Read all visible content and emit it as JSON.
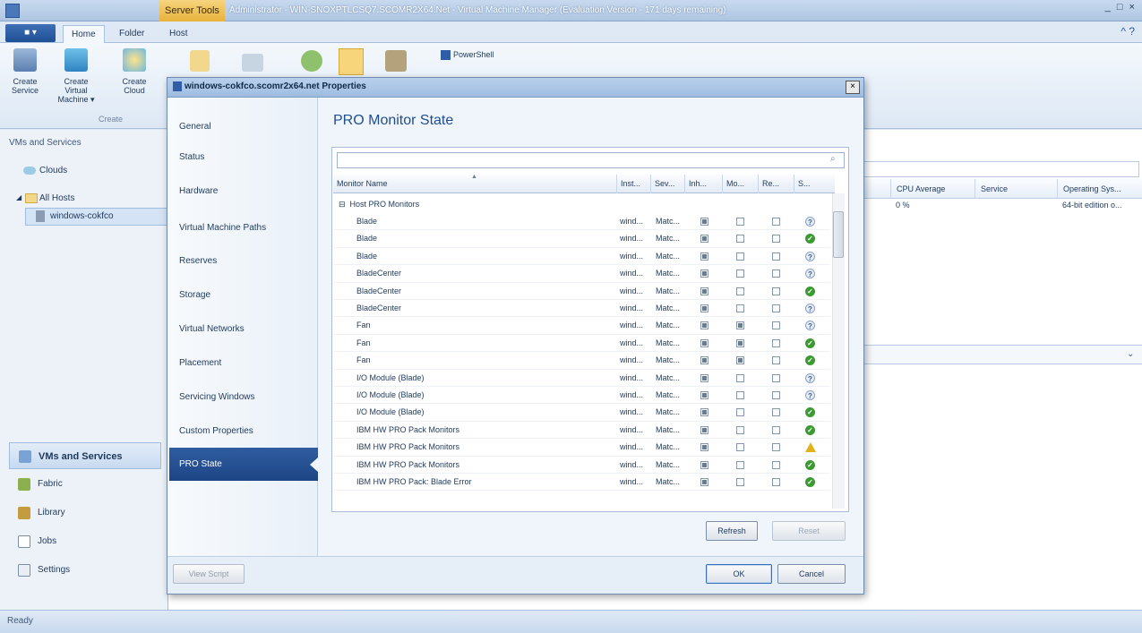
{
  "window": {
    "server_tools": "Server Tools",
    "title": "Administrator - WIN-SNOXPTLCSQ7.SCOMR2X64.Net - Virtual Machine Manager (Evaluation Version - 171 days remaining)",
    "controls": "_ □ ×"
  },
  "ribbon": {
    "file_label": "■ ▾",
    "tabs": [
      "Home",
      "Folder",
      "Host"
    ],
    "help": "^ ?",
    "buttons": [
      {
        "label": "Create Service",
        "icon": "service-icon"
      },
      {
        "label": "Create Virtual Machine ▾",
        "icon": "vm-icon"
      },
      {
        "label": "Create Cloud",
        "icon": "cloud-icon"
      }
    ],
    "group_label": "Create",
    "powershell": "PowerShell"
  },
  "nav": {
    "title": "VMs and Services",
    "tree": [
      "Clouds",
      "All Hosts",
      "windows-cokfco"
    ],
    "workspaces": [
      "VMs and Services",
      "Fabric",
      "Library",
      "Jobs",
      "Settings"
    ]
  },
  "background_grid": {
    "headers": [
      "CPU Average",
      "Service",
      "Operating Sys..."
    ],
    "row": [
      "0 %",
      "",
      "64-bit edition o..."
    ]
  },
  "status": "Ready",
  "dialog": {
    "title": "windows-cokfco.scomr2x64.net Properties",
    "close": "×",
    "nav": [
      "General",
      "Status",
      "Hardware",
      "Virtual Machine Paths",
      "Reserves",
      "Storage",
      "Virtual Networks",
      "Placement",
      "Servicing Windows",
      "Custom Properties"
    ],
    "nav_selected": "PRO State",
    "heading": "PRO Monitor State",
    "search_placeholder": "",
    "columns": [
      "Monitor Name",
      "Inst...",
      "Sev...",
      "Inh...",
      "Mo...",
      "Re...",
      "S..."
    ],
    "group": "Host PRO Monitors",
    "rows": [
      {
        "name": "Blade",
        "inst": "wind...",
        "sev": "Matc...",
        "inh": true,
        "mo": false,
        "re": false,
        "state": "unknown"
      },
      {
        "name": "Blade",
        "inst": "wind...",
        "sev": "Matc...",
        "inh": true,
        "mo": false,
        "re": false,
        "state": "ok"
      },
      {
        "name": "Blade",
        "inst": "wind...",
        "sev": "Matc...",
        "inh": true,
        "mo": false,
        "re": false,
        "state": "unknown"
      },
      {
        "name": "BladeCenter",
        "inst": "wind...",
        "sev": "Matc...",
        "inh": true,
        "mo": false,
        "re": false,
        "state": "unknown"
      },
      {
        "name": "BladeCenter",
        "inst": "wind...",
        "sev": "Matc...",
        "inh": true,
        "mo": false,
        "re": false,
        "state": "ok"
      },
      {
        "name": "BladeCenter",
        "inst": "wind...",
        "sev": "Matc...",
        "inh": true,
        "mo": false,
        "re": false,
        "state": "unknown"
      },
      {
        "name": "Fan",
        "inst": "wind...",
        "sev": "Matc...",
        "inh": true,
        "mo": true,
        "re": false,
        "state": "unknown"
      },
      {
        "name": "Fan",
        "inst": "wind...",
        "sev": "Matc...",
        "inh": true,
        "mo": true,
        "re": false,
        "state": "ok"
      },
      {
        "name": "Fan",
        "inst": "wind...",
        "sev": "Matc...",
        "inh": true,
        "mo": true,
        "re": false,
        "state": "ok"
      },
      {
        "name": "I/O Module (Blade)",
        "inst": "wind...",
        "sev": "Matc...",
        "inh": true,
        "mo": false,
        "re": false,
        "state": "unknown"
      },
      {
        "name": "I/O Module (Blade)",
        "inst": "wind...",
        "sev": "Matc...",
        "inh": true,
        "mo": false,
        "re": false,
        "state": "unknown"
      },
      {
        "name": "I/O Module (Blade)",
        "inst": "wind...",
        "sev": "Matc...",
        "inh": true,
        "mo": false,
        "re": false,
        "state": "ok"
      },
      {
        "name": "IBM HW PRO Pack Monitors",
        "inst": "wind...",
        "sev": "Matc...",
        "inh": true,
        "mo": false,
        "re": false,
        "state": "ok"
      },
      {
        "name": "IBM HW PRO Pack Monitors",
        "inst": "wind...",
        "sev": "Matc...",
        "inh": true,
        "mo": false,
        "re": false,
        "state": "warning"
      },
      {
        "name": "IBM HW PRO Pack Monitors",
        "inst": "wind...",
        "sev": "Matc...",
        "inh": true,
        "mo": false,
        "re": false,
        "state": "ok"
      },
      {
        "name": "IBM HW PRO Pack: Blade Error",
        "inst": "wind...",
        "sev": "Matc...",
        "inh": true,
        "mo": false,
        "re": false,
        "state": "ok"
      }
    ],
    "buttons": {
      "refresh": "Refresh",
      "reset": "Reset",
      "view_script": "View Script",
      "ok": "OK",
      "cancel": "Cancel"
    }
  }
}
